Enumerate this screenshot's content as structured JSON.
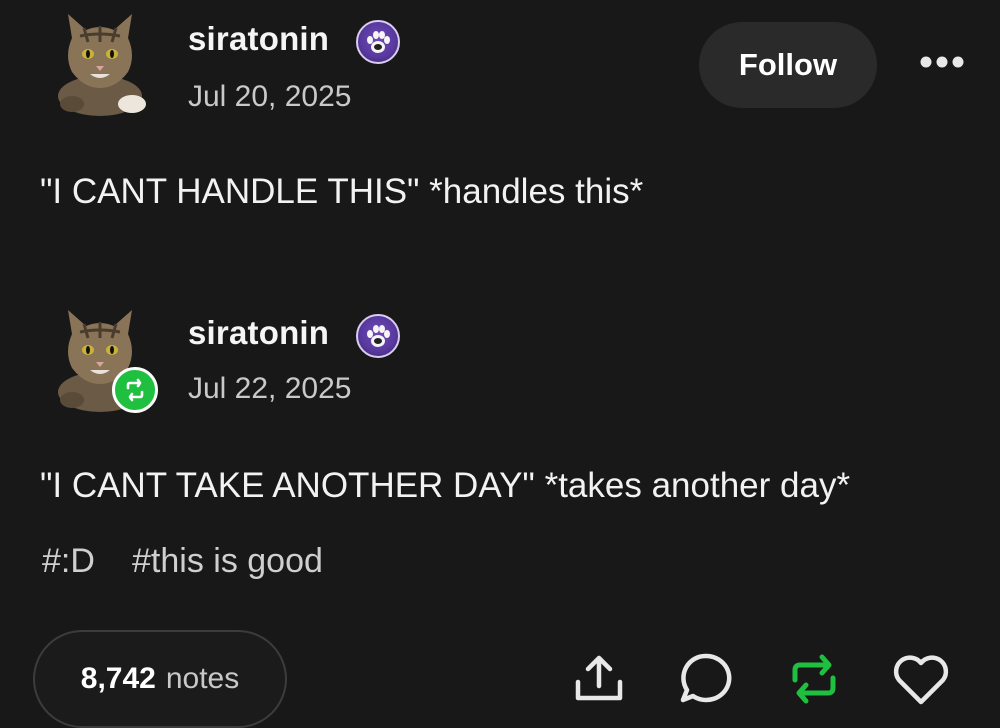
{
  "post1": {
    "username": "siratonin",
    "date": "Jul 20, 2025",
    "text": "\"I CANT HANDLE THIS\" *handles this*"
  },
  "post2": {
    "username": "siratonin",
    "date": "Jul 22, 2025",
    "text": "\"I CANT TAKE ANOTHER DAY\" *takes another day*",
    "tags": [
      "#:D",
      "#this is good"
    ]
  },
  "actions": {
    "follow_label": "Follow",
    "notes_count": "8,742",
    "notes_label": "notes"
  },
  "colors": {
    "background": "#181818",
    "reblog_green": "#1fbf3f",
    "badge_purple": "#5a3aa0"
  },
  "icons": [
    "more-options-icon",
    "share-icon",
    "reply-icon",
    "reblog-icon",
    "like-icon",
    "paw-badge-icon",
    "reblog-badge-icon"
  ]
}
